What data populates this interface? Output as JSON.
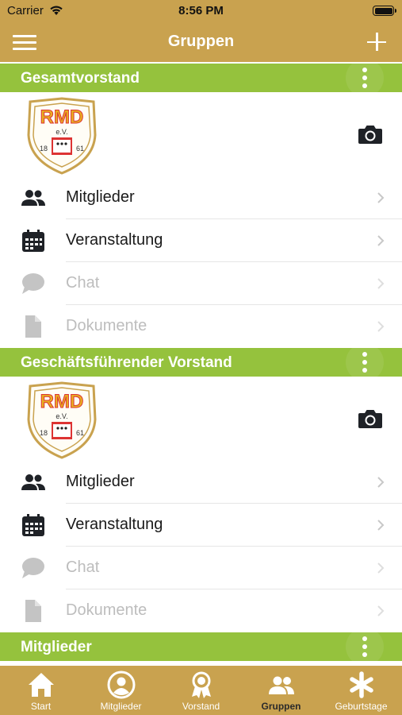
{
  "status_bar": {
    "carrier": "Carrier",
    "time": "8:56 PM"
  },
  "nav": {
    "title": "Gruppen"
  },
  "colors": {
    "gold": "#c9a24f",
    "green": "#95c23d",
    "icon_dark": "#1f2227",
    "icon_disabled": "#c4c4c4"
  },
  "groups": [
    {
      "title": "Gesamtvorstand",
      "rows": [
        {
          "label": "Mitglieder",
          "icon": "members-icon",
          "enabled": true
        },
        {
          "label": "Veranstaltung",
          "icon": "calendar-icon",
          "enabled": true
        },
        {
          "label": "Chat",
          "icon": "chat-icon",
          "enabled": false
        },
        {
          "label": "Dokumente",
          "icon": "document-icon",
          "enabled": false
        }
      ]
    },
    {
      "title": "Geschäftsführender Vorstand",
      "rows": [
        {
          "label": "Mitglieder",
          "icon": "members-icon",
          "enabled": true
        },
        {
          "label": "Veranstaltung",
          "icon": "calendar-icon",
          "enabled": true
        },
        {
          "label": "Chat",
          "icon": "chat-icon",
          "enabled": false
        },
        {
          "label": "Dokumente",
          "icon": "document-icon",
          "enabled": false
        }
      ]
    },
    {
      "title": "Mitglieder"
    }
  ],
  "logo": {
    "letters": "RMD",
    "ev": "e.V.",
    "year_left": "18",
    "year_right": "61"
  },
  "tabs": [
    {
      "label": "Start",
      "icon": "home-icon",
      "active": false
    },
    {
      "label": "Mitglieder",
      "icon": "person-icon",
      "active": false
    },
    {
      "label": "Vorstand",
      "icon": "award-icon",
      "active": false
    },
    {
      "label": "Gruppen",
      "icon": "group-icon",
      "active": true
    },
    {
      "label": "Geburtstage",
      "icon": "asterisk-icon",
      "active": false
    }
  ]
}
